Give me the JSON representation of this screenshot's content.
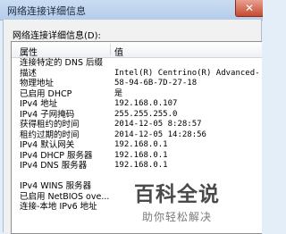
{
  "window": {
    "title": "网络连接详细信息",
    "close_glyph": "✕"
  },
  "dialog": {
    "label": "网络连接详细信息(D):"
  },
  "columns": {
    "property": "属性",
    "value": "值"
  },
  "rows": [
    {
      "property": "连接特定的 DNS 后缀",
      "value": ""
    },
    {
      "property": "描述",
      "value": "Intel(R) Centrino(R) Advanced-"
    },
    {
      "property": "物理地址",
      "value": "58-94-6B-7D-27-18"
    },
    {
      "property": "已启用 DHCP",
      "value": "是"
    },
    {
      "property": "IPv4 地址",
      "value": "192.168.0.107"
    },
    {
      "property": "IPv4 子网掩码",
      "value": "255.255.255.0"
    },
    {
      "property": "获得租约的时间",
      "value": "2014-12-05 8:28:57"
    },
    {
      "property": "租约过期的时间",
      "value": "2014-12-05 14:28:56"
    },
    {
      "property": "IPv4 默认网关",
      "value": "192.168.0.1"
    },
    {
      "property": "IPv4 DHCP 服务器",
      "value": "192.168.0.1"
    },
    {
      "property": "IPv4 DNS 服务器",
      "value": "192.168.0.1"
    },
    {
      "property": "",
      "value": ""
    },
    {
      "property": "IPv4 WINS 服务器",
      "value": ""
    },
    {
      "property": "已启用 NetBIOS ove...",
      "value": ""
    },
    {
      "property": "连接-本地 IPv6 地址",
      "value": ""
    }
  ],
  "watermark": {
    "title": "百科全说",
    "subtitle": "助你轻松解决"
  }
}
